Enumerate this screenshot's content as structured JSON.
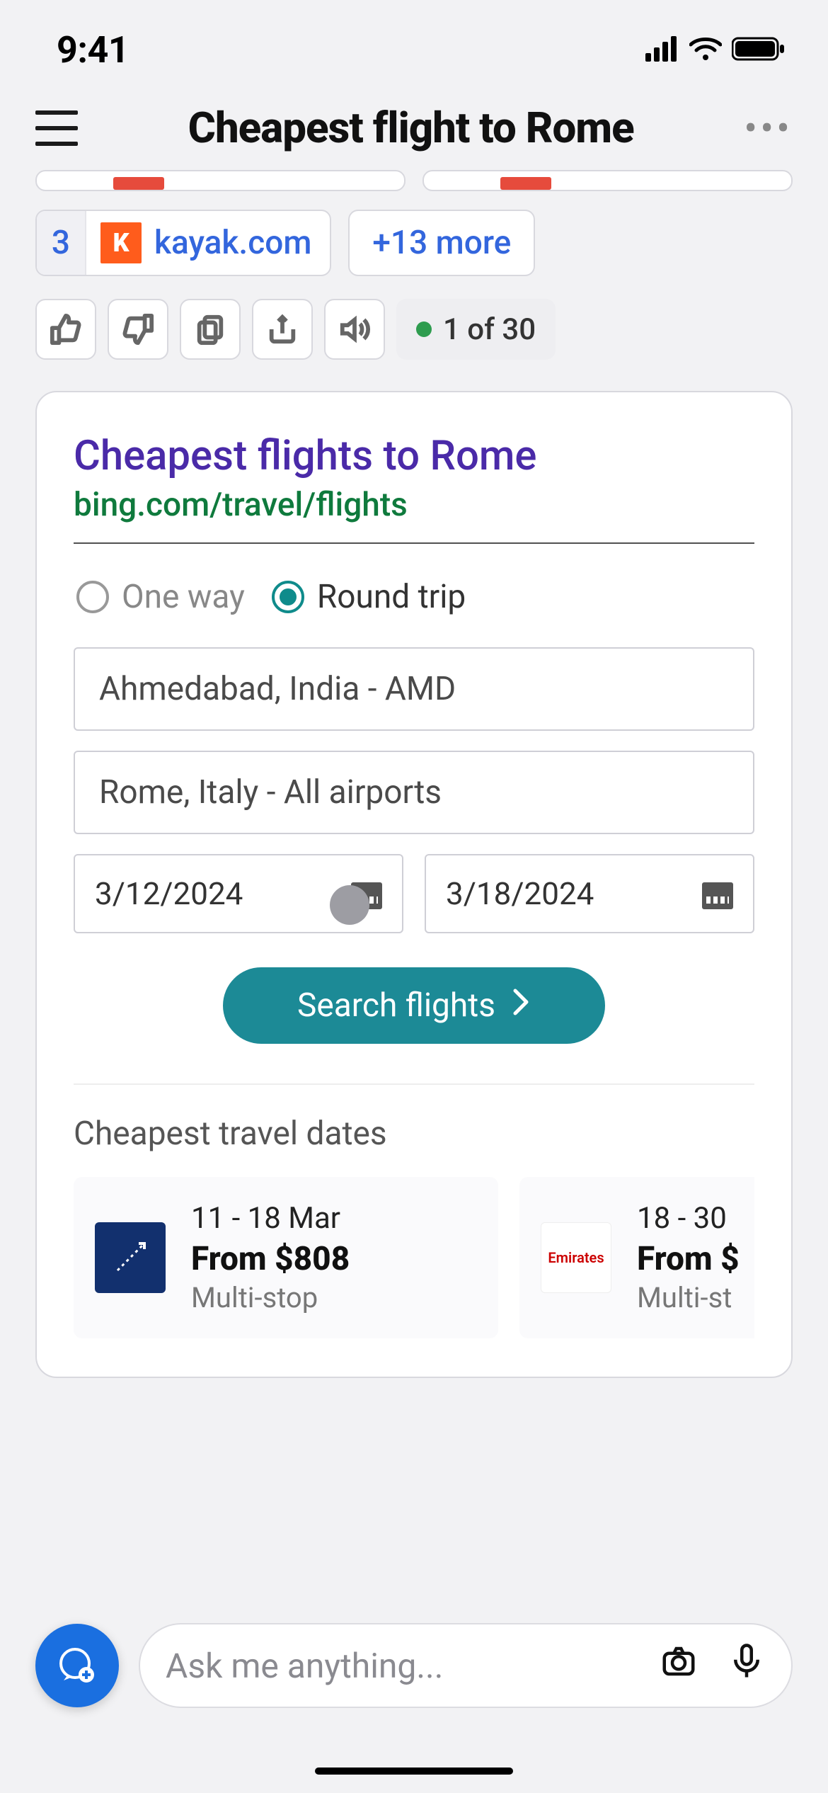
{
  "status": {
    "time": "9:41"
  },
  "nav": {
    "title": "Cheapest flight to Rome"
  },
  "chips": {
    "rank": "3",
    "kayak_label": "kayak.com",
    "more_label": "+13 more"
  },
  "counter": {
    "text": "1 of 30"
  },
  "card": {
    "title": "Cheapest flights to Rome",
    "url": "bing.com/travel/flights",
    "trip": {
      "oneway": "One way",
      "roundtrip": "Round trip"
    },
    "from": "Ahmedabad, India - AMD",
    "to": "Rome,  Italy - All airports",
    "date_depart": "3/12/2024",
    "date_return": "3/18/2024",
    "search_label": "Search flights",
    "cheapest_label": "Cheapest travel dates",
    "deals": [
      {
        "dates": "11 - 18 Mar",
        "price": "From $808",
        "stops": "Multi-stop",
        "logo": "generic"
      },
      {
        "dates": "18 - 30",
        "price": "From $",
        "stops": "Multi-st",
        "logo": "emirates"
      }
    ]
  },
  "bottom": {
    "placeholder": "Ask me anything..."
  }
}
